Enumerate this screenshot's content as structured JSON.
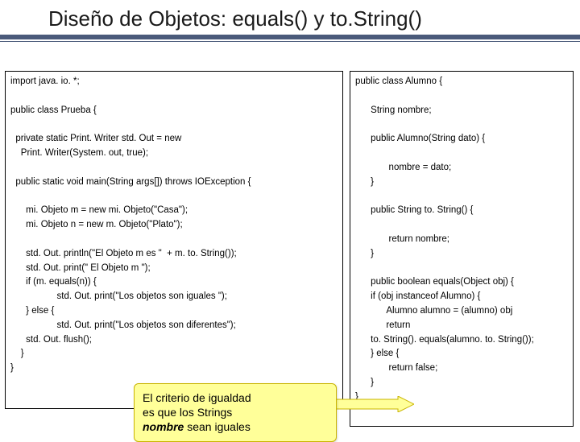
{
  "title": "Diseño de Objetos: equals() y to.String()",
  "code_left": "import java. io. *;\n\npublic class Prueba {\n\n  private static Print. Writer std. Out = new\n    Print. Writer(System. out, true);\n\n  public static void main(String args[]) throws IOException {\n\n      mi. Objeto m = new mi. Objeto(\"Casa\");\n      mi. Objeto n = new m. Objeto(\"Plato\");\n\n      std. Out. println(\"El Objeto m es \"  + m. to. String());\n      std. Out. print(\" El Objeto m \");\n      if (m. equals(n)) {\n                  std. Out. print(\"Los objetos son iguales \");\n      } else {\n                  std. Out. print(\"Los objetos son diferentes\");\n      std. Out. flush();\n    }\n}",
  "code_right": "public class Alumno {\n\n      String nombre;\n\n      public Alumno(String dato) {\n\n             nombre = dato;\n      }\n\n      public String to. String() {\n\n             return nombre;\n      }\n\n      public boolean equals(Object obj) {\n      if (obj instanceof Alumno) {\n            Alumno alumno = (alumno) obj\n            return\n      to. String(). equals(alumno. to. String());\n      } else {\n             return false;\n      }\n}",
  "callout": {
    "line1": "El criterio de igualdad",
    "line2": "es que los Strings",
    "em": "nombre",
    "line3": " sean iguales"
  }
}
